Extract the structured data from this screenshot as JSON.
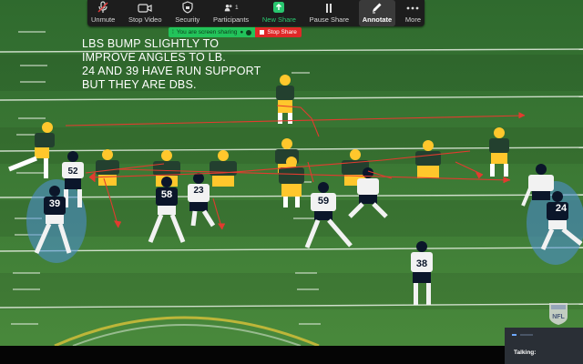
{
  "toolbar": {
    "items": [
      {
        "label": "Unmute",
        "icon": "muted-microphone-icon"
      },
      {
        "label": "Stop Video",
        "icon": "video-camera-icon"
      },
      {
        "label": "Security",
        "icon": "shield-icon"
      },
      {
        "label": "Participants",
        "icon": "participants-icon",
        "count": "1"
      },
      {
        "label": "New Share",
        "icon": "share-arrow-icon"
      },
      {
        "label": "Pause Share",
        "icon": "pause-icon"
      },
      {
        "label": "Annotate",
        "icon": "pencil-icon"
      },
      {
        "label": "More",
        "icon": "more-dots-icon"
      }
    ]
  },
  "share_banner": {
    "status_text": "You are screen sharing",
    "stop_label": "Stop Share"
  },
  "annotation": {
    "lines": [
      "LBS BUMP SLIGHTLY TO",
      "IMPROVE ANGLES TO LB.",
      "24 AND 39 HAVE RUN SUPPORT",
      "BUT THEY ARE DBS."
    ],
    "color": "#ffffff"
  },
  "field": {
    "grass": "#3f7a35",
    "line_color": "#e8f0e4",
    "arrow_color": "#e23b2f",
    "highlight_color": "#4f90d8"
  },
  "players": {
    "home_jersey": "#23402f",
    "home_helmet": "#ffc72c",
    "away_jersey": "#0b162a",
    "away_helmet": "#0b162a",
    "away_numbers": [
      "52",
      "39",
      "58",
      "23",
      "59",
      "24",
      "38"
    ]
  },
  "broadcast": {
    "logo": "NFL"
  },
  "talking_panel": {
    "label": "Talking:"
  }
}
